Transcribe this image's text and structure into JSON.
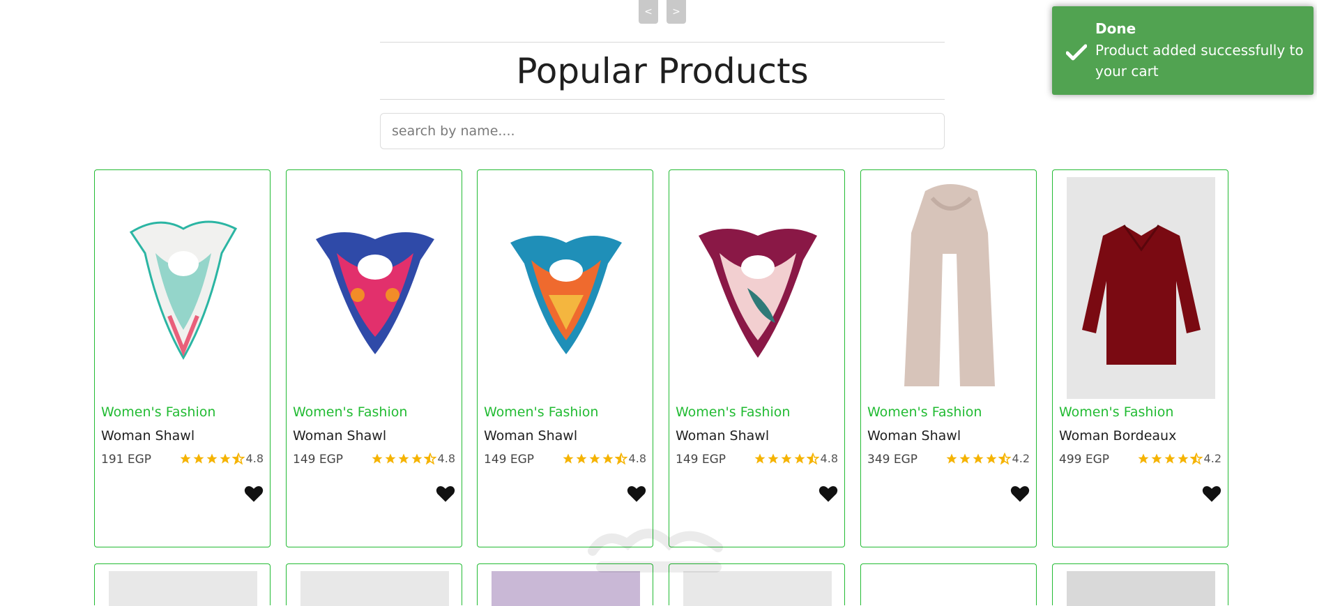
{
  "pager": {
    "prev": "<",
    "next": ">"
  },
  "title": "Popular Products",
  "search": {
    "placeholder": "search by name...."
  },
  "toast": {
    "title": "Done",
    "message": "Product added successfully to your cart"
  },
  "colors": {
    "accent": "#22bb33",
    "toast": "#51a351",
    "star": "#f5b301"
  },
  "products": [
    {
      "category": "Women's Fashion",
      "name": "Woman Shawl",
      "price": "191 EGP",
      "rating": "4.8"
    },
    {
      "category": "Women's Fashion",
      "name": "Woman Shawl",
      "price": "149 EGP",
      "rating": "4.8"
    },
    {
      "category": "Women's Fashion",
      "name": "Woman Shawl",
      "price": "149 EGP",
      "rating": "4.8"
    },
    {
      "category": "Women's Fashion",
      "name": "Woman Shawl",
      "price": "149 EGP",
      "rating": "4.8"
    },
    {
      "category": "Women's Fashion",
      "name": "Woman Shawl",
      "price": "349 EGP",
      "rating": "4.2"
    },
    {
      "category": "Women's Fashion",
      "name": "Woman Bordeaux",
      "price": "499 EGP",
      "rating": "4.2"
    }
  ]
}
